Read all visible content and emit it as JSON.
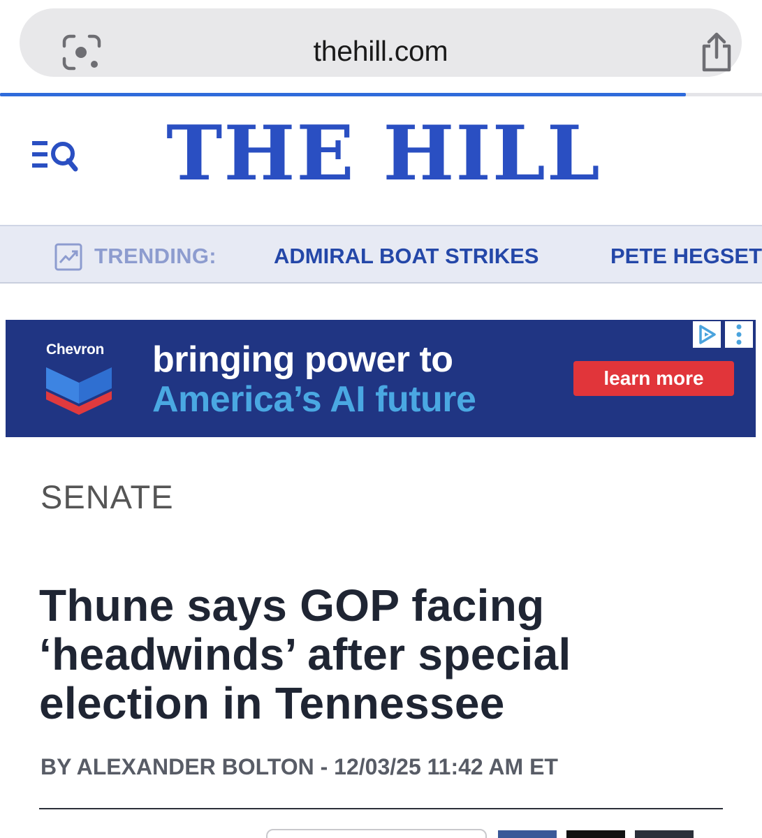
{
  "browser": {
    "url": "thehill.com",
    "lens_icon": "camera-search-icon",
    "share_icon": "share-icon",
    "load_progress": 0.9
  },
  "header": {
    "logo": "THE HILL",
    "menu_icon": "menu-search-icon",
    "logo_color": "#2a4fc2"
  },
  "trending": {
    "label": "TRENDING:",
    "icon": "trending-chart-icon",
    "items": [
      "ADMIRAL BOAT STRIKES",
      "PETE HEGSETH"
    ]
  },
  "ad": {
    "brand": "Chevron",
    "line1": "bringing power to",
    "line2": "America’s AI future",
    "cta": "learn more",
    "background": "#203583",
    "cta_color": "#e1353a"
  },
  "article": {
    "section": "SENATE",
    "headline": "Thune says GOP facing ‘headwinds’ after special election in Tennessee",
    "byline": "BY ALEXANDER BOLTON - 12/03/25 11:42 AM ET"
  },
  "colors": {
    "accent": "#2447a8",
    "progress": "#2f6bdb",
    "headline": "#1f2533"
  }
}
